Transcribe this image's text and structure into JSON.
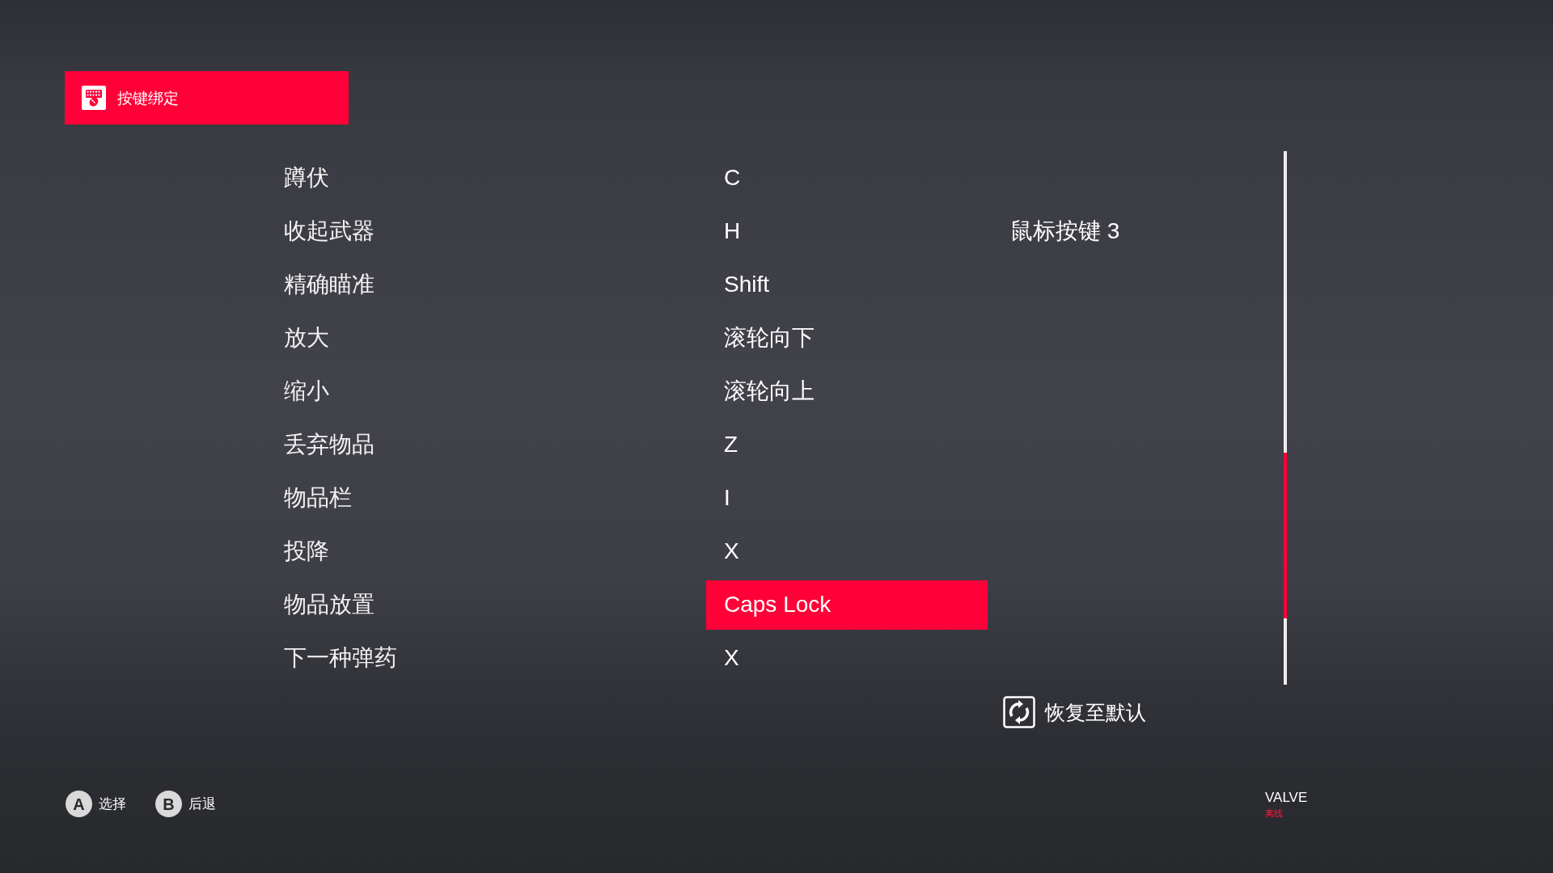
{
  "header": {
    "title": "按键绑定"
  },
  "rows": [
    {
      "action": "蹲伏",
      "primary": {
        "key": "C",
        "selected": false
      }
    },
    {
      "action": "收起武器",
      "primary": {
        "key": "H",
        "selected": false
      },
      "secondary": {
        "key": "鼠标按键 3",
        "selected": false
      }
    },
    {
      "action": "精确瞄准",
      "primary": {
        "key": "Shift",
        "selected": false
      }
    },
    {
      "action": "放大",
      "primary": {
        "key": "滚轮向下",
        "selected": false
      }
    },
    {
      "action": "缩小",
      "primary": {
        "key": "滚轮向上",
        "selected": false
      }
    },
    {
      "action": "丢弃物品",
      "primary": {
        "key": "Z",
        "selected": false
      }
    },
    {
      "action": "物品栏",
      "primary": {
        "key": "I",
        "selected": false
      }
    },
    {
      "action": "投降",
      "primary": {
        "key": "X",
        "selected": false
      }
    },
    {
      "action": "物品放置",
      "primary": {
        "key": "Caps Lock",
        "selected": true
      }
    },
    {
      "action": "下一种弹药",
      "primary": {
        "key": "X",
        "selected": false
      }
    }
  ],
  "restore_button": {
    "label": "恢复至默认"
  },
  "hints": [
    {
      "button": "A",
      "label": "选择"
    },
    {
      "button": "B",
      "label": "后退"
    }
  ],
  "account": {
    "name": "VALVE",
    "status": "离线"
  }
}
